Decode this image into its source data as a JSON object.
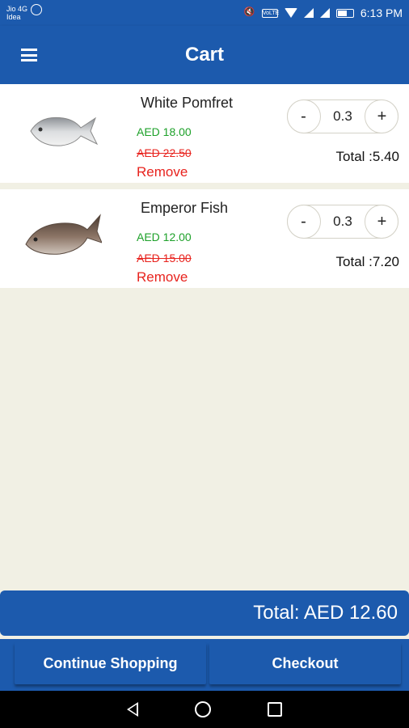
{
  "status_bar": {
    "carrier_1": "Jio 4G",
    "carrier_2": "Idea",
    "volte": "VoLTE",
    "time": "6:13 PM"
  },
  "app_bar": {
    "title": "Cart"
  },
  "cart": {
    "items": [
      {
        "name": "White Pomfret",
        "price": "AED 18.00",
        "old_price": "AED 22.50",
        "remove_label": "Remove",
        "minus_label": "-",
        "quantity": "0.3",
        "plus_label": "+",
        "total": "Total :5.40"
      },
      {
        "name": "Emperor Fish",
        "price": "AED 12.00",
        "old_price": "AED 15.00",
        "remove_label": "Remove",
        "minus_label": "-",
        "quantity": "0.3",
        "plus_label": "+",
        "total": "Total :7.20"
      }
    ]
  },
  "summary": {
    "total": "Total: AED 12.60"
  },
  "actions": {
    "continue_label": "Continue Shopping",
    "checkout_label": "Checkout"
  },
  "colors": {
    "primary": "#1c5aad",
    "background": "#f1f0e4",
    "price_green": "#1ea12a",
    "red": "#e8231e"
  }
}
